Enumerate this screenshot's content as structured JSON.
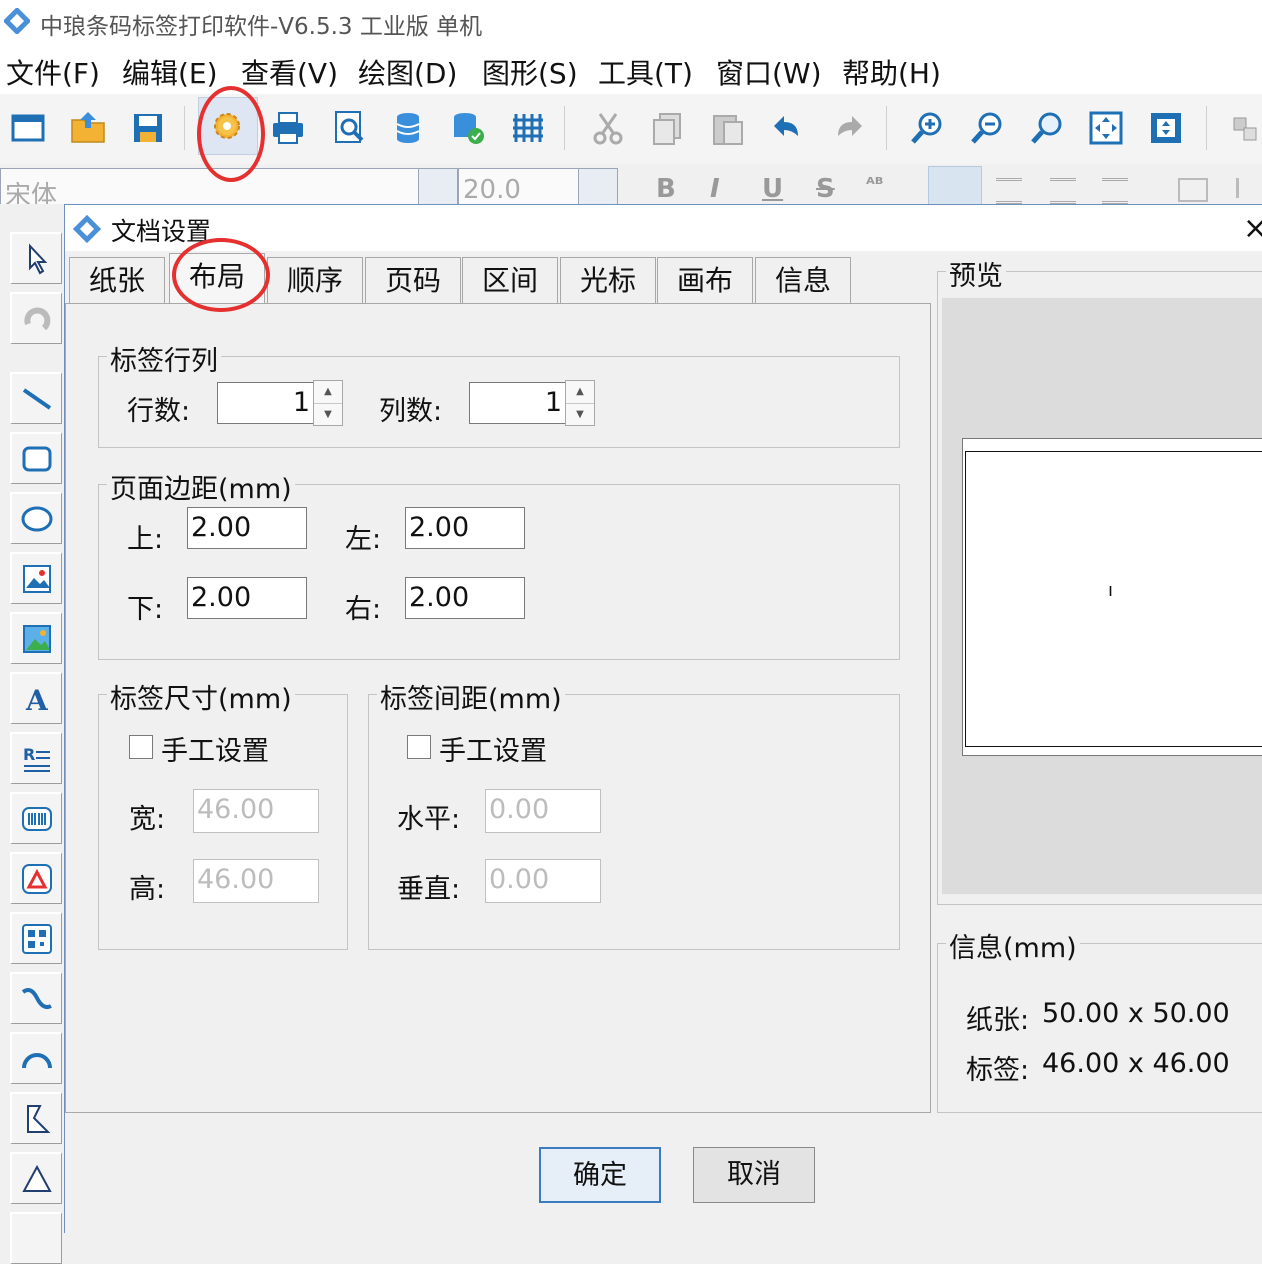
{
  "app": {
    "title": "中琅条码标签打印软件-V6.5.3 工业版 单机"
  },
  "menu": [
    "文件(F)",
    "编辑(E)",
    "查看(V)",
    "绘图(D)",
    "图形(S)",
    "工具(T)",
    "窗口(W)",
    "帮助(H)"
  ],
  "toolbar": {
    "items": [
      "new-document-icon",
      "open-folder-icon",
      "save-icon",
      "document-settings-gear-icon",
      "print-icon",
      "print-preview-icon",
      "database-icon",
      "database-settings-icon",
      "grid-icon",
      "cut-icon",
      "copy-icon",
      "paste-icon",
      "undo-icon",
      "redo-icon",
      "zoom-in-icon",
      "zoom-out-icon",
      "zoom-icon",
      "fit-page-icon",
      "actual-size-icon",
      "align-icon"
    ],
    "selected": "document-settings-gear-icon"
  },
  "fontbar": {
    "font_name": "宋体",
    "font_size": "20.0"
  },
  "toolbox": [
    "pointer-icon",
    "rotate-icon",
    "line-icon",
    "rectangle-icon",
    "ellipse-icon",
    "image-icon",
    "picture-icon",
    "text-icon",
    "rich-text-icon",
    "barcode-icon",
    "qr-code-icon",
    "matrix-code-icon",
    "curve-icon",
    "arc-icon",
    "polygon-icon",
    "triangle-icon"
  ],
  "dialog": {
    "title": "文档设置",
    "close_label": "×",
    "tabs": [
      "纸张",
      "布局",
      "顺序",
      "页码",
      "区间",
      "光标",
      "画布",
      "信息"
    ],
    "active_tab": "布局",
    "label_rows_cols": {
      "title": "标签行列",
      "rows_label": "行数:",
      "rows_value": "1",
      "cols_label": "列数:",
      "cols_value": "1"
    },
    "margins": {
      "title": "页面边距(mm)",
      "top_label": "上:",
      "top_value": "2.00",
      "left_label": "左:",
      "left_value": "2.00",
      "bottom_label": "下:",
      "bottom_value": "2.00",
      "right_label": "右:",
      "right_value": "2.00"
    },
    "label_size": {
      "title": "标签尺寸(mm)",
      "manual_label": "手工设置",
      "width_label": "宽:",
      "width_value": "46.00",
      "height_label": "高:",
      "height_value": "46.00"
    },
    "label_gap": {
      "title": "标签间距(mm)",
      "manual_label": "手工设置",
      "horizontal_label": "水平:",
      "horizontal_value": "0.00",
      "vertical_label": "垂直:",
      "vertical_value": "0.00"
    },
    "preview": {
      "title": "预览",
      "cursor_mark": "ı"
    },
    "info": {
      "title": "信息(mm)",
      "paper_label": "纸张:",
      "paper_value": "50.00 x 50.00",
      "label_label": "标签:",
      "label_value": "46.00 x 46.00"
    },
    "ok_label": "确定",
    "cancel_label": "取消"
  },
  "colors": {
    "highlight_circle": "#e53030",
    "accent": "#3b7bbf"
  }
}
